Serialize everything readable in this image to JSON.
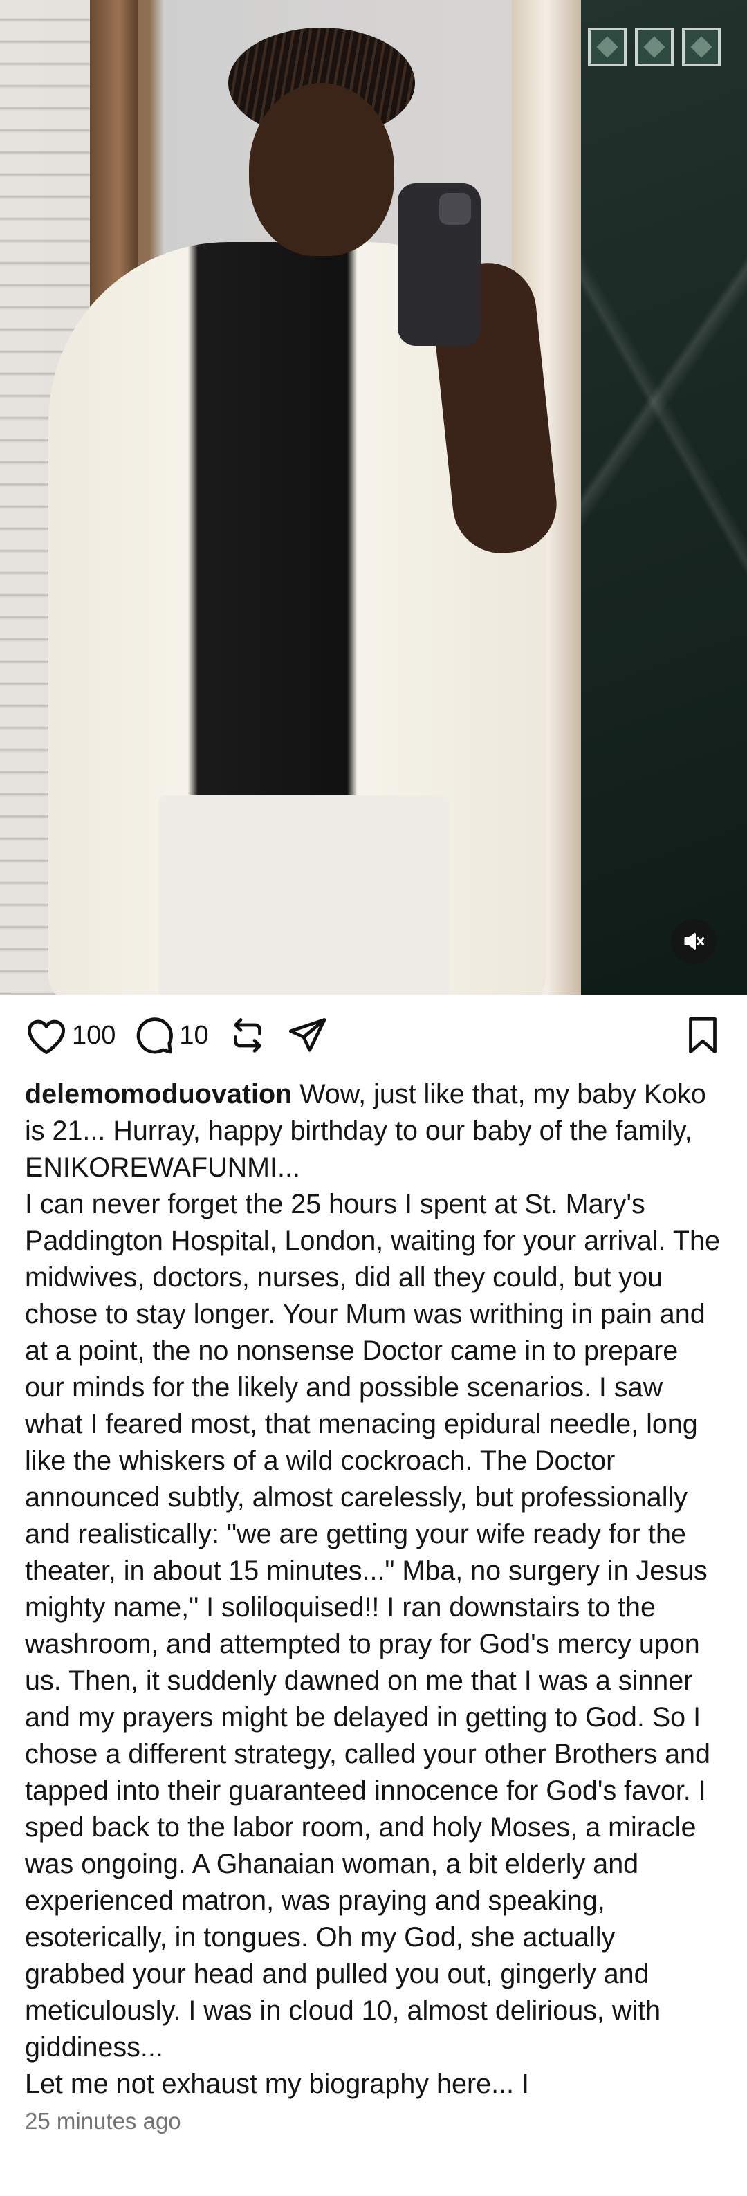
{
  "media": {
    "mute_icon": "speaker-muted-icon"
  },
  "actions": {
    "like_icon": "heart-icon",
    "like_count": "100",
    "comment_icon": "comment-bubble-icon",
    "comment_count": "10",
    "repost_icon": "repost-icon",
    "share_icon": "send-icon",
    "save_icon": "bookmark-icon"
  },
  "post": {
    "username": "delemomoduovation",
    "caption_first": " Wow, just like that, my baby Koko is 21... Hurray, happy birthday to our baby of the family, ENIKOREWAFUNMI...",
    "caption_body": "I can never forget the 25 hours I spent at St. Mary's Paddington Hospital, London, waiting for your arrival. The midwives, doctors, nurses, did all they could, but you chose to stay longer. Your Mum was writhing in pain and at a point, the no nonsense Doctor came in to prepare our minds for the likely and possible scenarios. I saw what I feared most, that menacing epidural needle, long like the whiskers of a wild cockroach. The Doctor announced subtly, almost carelessly, but professionally and realistically: \"we are getting your wife ready for the theater, in about 15 minutes...\" Mba, no surgery in Jesus mighty name,\" I soliloquised!! I ran downstairs to the washroom, and attempted to pray for God's mercy upon us. Then, it suddenly dawned on me that I was a sinner and my prayers might be delayed in getting to God. So I chose a different strategy, called your other Brothers and tapped into their guaranteed innocence for God's favor. I sped back to the labor room, and holy Moses, a miracle was ongoing. A Ghanaian woman, a bit elderly and experienced matron, was praying and speaking, esoterically, in tongues. Oh my God, she actually grabbed your head and pulled you out, gingerly and meticulously. I was in cloud 10, almost delirious, with giddiness...",
    "caption_last": "Let me not exhaust my biography here... I",
    "timestamp": "25 minutes ago"
  }
}
